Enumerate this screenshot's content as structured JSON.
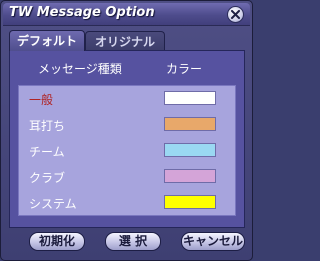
{
  "window": {
    "title": "TW Message Option"
  },
  "tabs": [
    {
      "label": "デフォルト",
      "active": true
    },
    {
      "label": "オリジナル",
      "active": false
    }
  ],
  "headers": {
    "type": "メッセージ種類",
    "color": "カラー"
  },
  "rows": [
    {
      "label": "一般",
      "color": "#ffffff",
      "active": true
    },
    {
      "label": "耳打ち",
      "color": "#e8a86a",
      "active": false
    },
    {
      "label": "チーム",
      "color": "#9ad8f2",
      "active": false
    },
    {
      "label": "クラブ",
      "color": "#d4a4d8",
      "active": false
    },
    {
      "label": "システム",
      "color": "#ffff00",
      "active": false
    }
  ],
  "buttons": {
    "init": "初期化",
    "select": "選 択",
    "cancel": "キャンセル"
  },
  "icons": {
    "close": "close-icon"
  }
}
